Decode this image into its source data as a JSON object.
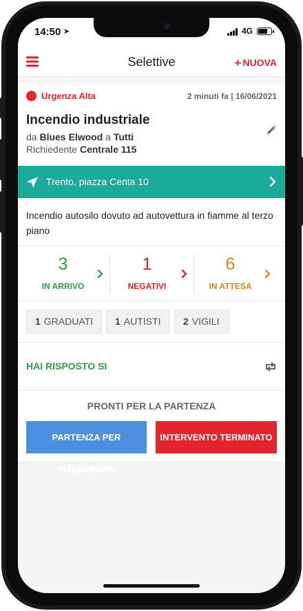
{
  "status_bar": {
    "time": "14:50",
    "network": "4G",
    "battery_level": 0.75
  },
  "header": {
    "title": "Selettive",
    "new_label": "NUOVA"
  },
  "alert": {
    "urgency": "Urgenza Alta",
    "when": "2 minuti fa | 16/06/2021",
    "title": "Incendio industriale",
    "from_prefix": "da",
    "sender": "Blues Elwood",
    "to_prefix": "a",
    "recipient": "Tutti",
    "requester_prefix": "Richiedente",
    "requester": "Centrale 115"
  },
  "location": {
    "address": "Trento, piazza Centa 10"
  },
  "description": "Incendio autosilo dovuto ad autovettura in fiamme al terzo piano",
  "stats": [
    {
      "count": "3",
      "label": "IN ARRIVO",
      "color": "#29a146"
    },
    {
      "count": "1",
      "label": "NEGATIVI",
      "color": "#e5252e"
    },
    {
      "count": "6",
      "label": "IN ATTESA",
      "color": "#d68a1c"
    }
  ],
  "roles": [
    {
      "count": "1",
      "label": "GRADUATI"
    },
    {
      "count": "1",
      "label": "AUTISTI"
    },
    {
      "count": "2",
      "label": "VIGILI"
    }
  ],
  "response": {
    "text": "HAI RISPOSTO SI"
  },
  "departure": {
    "title": "PRONTI PER LA PARTENZA",
    "intervention_label": "PARTENZA PER INTERVENTO",
    "terminated_label": "INTERVENTO TERMINATO"
  },
  "colors": {
    "accent_red": "#e5252e",
    "teal": "#1aab9b",
    "green": "#29a146",
    "orange": "#d68a1c",
    "blue": "#4a8fe0"
  },
  "icons": [
    "menu-icon",
    "location-arrow-icon",
    "chevron-right-icon",
    "pencil-icon",
    "retweet-icon",
    "plus-icon"
  ]
}
